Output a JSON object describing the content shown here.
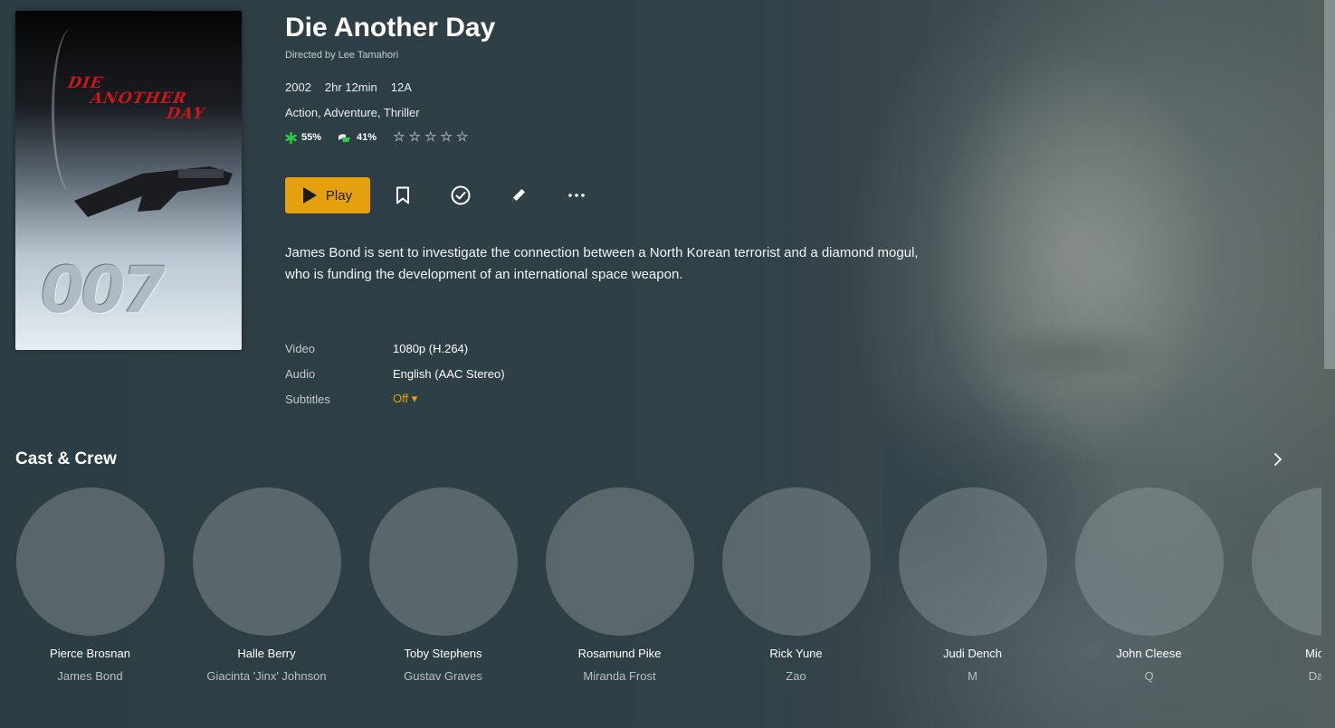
{
  "movie": {
    "title": "Die Another Day",
    "director": "Directed by Lee Tamahori",
    "year": "2002",
    "duration": "2hr 12min",
    "certificate": "12A",
    "genres": "Action, Adventure, Thriller",
    "critic_rating": "55%",
    "audience_rating": "41%",
    "user_stars": 0,
    "summary": "James Bond is sent to investigate the connection between a North Korean terrorist and a diamond mogul, who is funding the development of an international space weapon."
  },
  "poster": {
    "title_line1": "DIE",
    "title_line2": "ANOTHER",
    "title_line3": "DAY",
    "logo": "007"
  },
  "actions": {
    "play_label": "Play",
    "icons": [
      "bookmark-icon",
      "check-circle-icon",
      "pencil-icon",
      "more-icon"
    ]
  },
  "streams": {
    "video_label": "Video",
    "video_value": "1080p (H.264)",
    "audio_label": "Audio",
    "audio_value": "English (AAC Stereo)",
    "subtitles_label": "Subtitles",
    "subtitles_value": "Off ▾"
  },
  "cast_heading": "Cast & Crew",
  "cast": [
    {
      "name": "Pierce Brosnan",
      "role": "James Bond"
    },
    {
      "name": "Halle Berry",
      "role": "Giacinta 'Jinx' Johnson"
    },
    {
      "name": "Toby Stephens",
      "role": "Gustav Graves"
    },
    {
      "name": "Rosamund Pike",
      "role": "Miranda Frost"
    },
    {
      "name": "Rick Yune",
      "role": "Zao"
    },
    {
      "name": "Judi Dench",
      "role": "M"
    },
    {
      "name": "John Cleese",
      "role": "Q"
    },
    {
      "name": "Michael",
      "role": "Damia"
    }
  ],
  "colors": {
    "accent": "#e5a00d",
    "background": "#2e3f46",
    "critic_icon": "#2ecc40"
  }
}
